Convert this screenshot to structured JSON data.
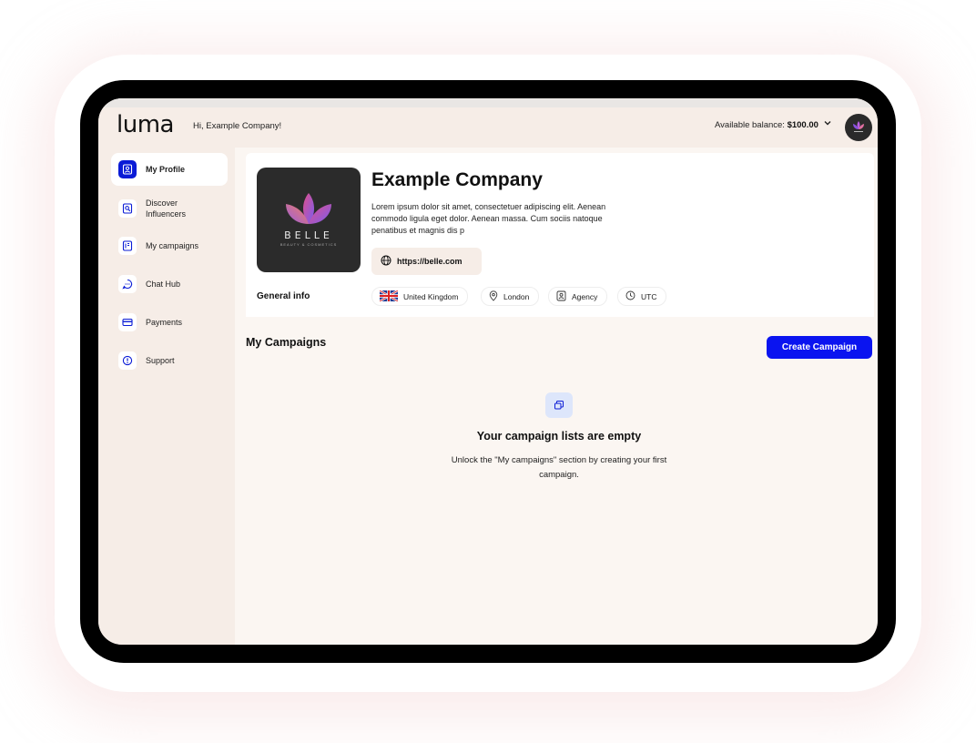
{
  "header": {
    "logo": "luma",
    "greeting": "Hi, Example Company!",
    "balance_label": "Available balance:",
    "balance_value": "$100.00"
  },
  "sidebar": {
    "items": [
      {
        "label": "My Profile",
        "icon": "profile-icon",
        "active": true
      },
      {
        "label": "Discover Influencers",
        "icon": "discover-icon",
        "active": false
      },
      {
        "label": "My campaigns",
        "icon": "campaigns-icon",
        "active": false
      },
      {
        "label": "Chat Hub",
        "icon": "chat-icon",
        "active": false
      },
      {
        "label": "Payments",
        "icon": "payments-icon",
        "active": false
      },
      {
        "label": "Support",
        "icon": "support-icon",
        "active": false
      }
    ]
  },
  "profile": {
    "brand_name": "BELLE",
    "brand_tagline": "BEAUTY & COSMETICS",
    "company_name": "Example Company",
    "description": "Lorem ipsum dolor sit amet, consectetuer adipiscing elit. Aenean commodo ligula eget dolor. Aenean massa. Cum sociis natoque penatibus et magnis dis p",
    "website": "https://belle.com",
    "general_info_label": "General info",
    "info_chips": {
      "country": "United Kingdom",
      "city": "London",
      "type": "Agency",
      "timezone": "UTC"
    }
  },
  "campaigns": {
    "title": "My Campaigns",
    "create_label": "Create Campaign",
    "empty_title": "Your campaign lists are empty",
    "empty_desc": "Unlock the \"My campaigns\" section by creating your first campaign."
  },
  "colors": {
    "accent": "#0a14f0",
    "sidebar_bg": "#f6ede7",
    "main_bg": "#fbf6f2",
    "tile_bg": "#2b2b2b"
  }
}
